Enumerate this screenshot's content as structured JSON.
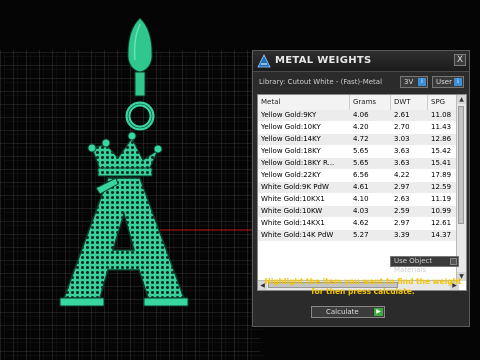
{
  "panel": {
    "title": "METAL WEIGHTS",
    "close_glyph": "X",
    "library": "Library: Cutout White - (Fast)-Metal",
    "toggle_3v": "3V",
    "toggle_user": "User",
    "toggle_icon": "i",
    "columns": [
      "Metal",
      "Grams",
      "DWT",
      "SPG"
    ],
    "rows": [
      [
        "Yellow Gold:9KY",
        "4.06",
        "2.61",
        "11.08"
      ],
      [
        "Yellow Gold:10KY",
        "4.20",
        "2.70",
        "11.43"
      ],
      [
        "Yellow Gold:14KY",
        "4.72",
        "3.03",
        "12.86"
      ],
      [
        "Yellow Gold:18KY",
        "5.65",
        "3.63",
        "15.42"
      ],
      [
        "Yellow Gold:18KY R...",
        "5.65",
        "3.63",
        "15.41"
      ],
      [
        "Yellow Gold:22KY",
        "6.56",
        "4.22",
        "17.89"
      ],
      [
        "White Gold:9K PdW",
        "4.61",
        "2.97",
        "12.59"
      ],
      [
        "White Gold:10KX1",
        "4.10",
        "2.63",
        "11.19"
      ],
      [
        "White Gold:10KW",
        "4.03",
        "2.59",
        "10.99"
      ],
      [
        "White Gold:14KX1",
        "4.62",
        "2.97",
        "12.61"
      ],
      [
        "White Gold:14K PdW",
        "5.27",
        "3.39",
        "14.37"
      ]
    ],
    "use_object_materials": "Use Object Materials",
    "hint": "Highlight the item you want to find the weight for then press calculate.",
    "calculate": "Calculate",
    "calculate_icon": "▶",
    "scroll_up": "▲",
    "scroll_down": "▼",
    "scroll_left": "◀",
    "scroll_right": "▶"
  },
  "colors": {
    "model_green": "#3ee0a8",
    "grid_line": "#4a4a4a",
    "hint_text": "#f2c400",
    "accent_blue": "#3a8fd8"
  }
}
